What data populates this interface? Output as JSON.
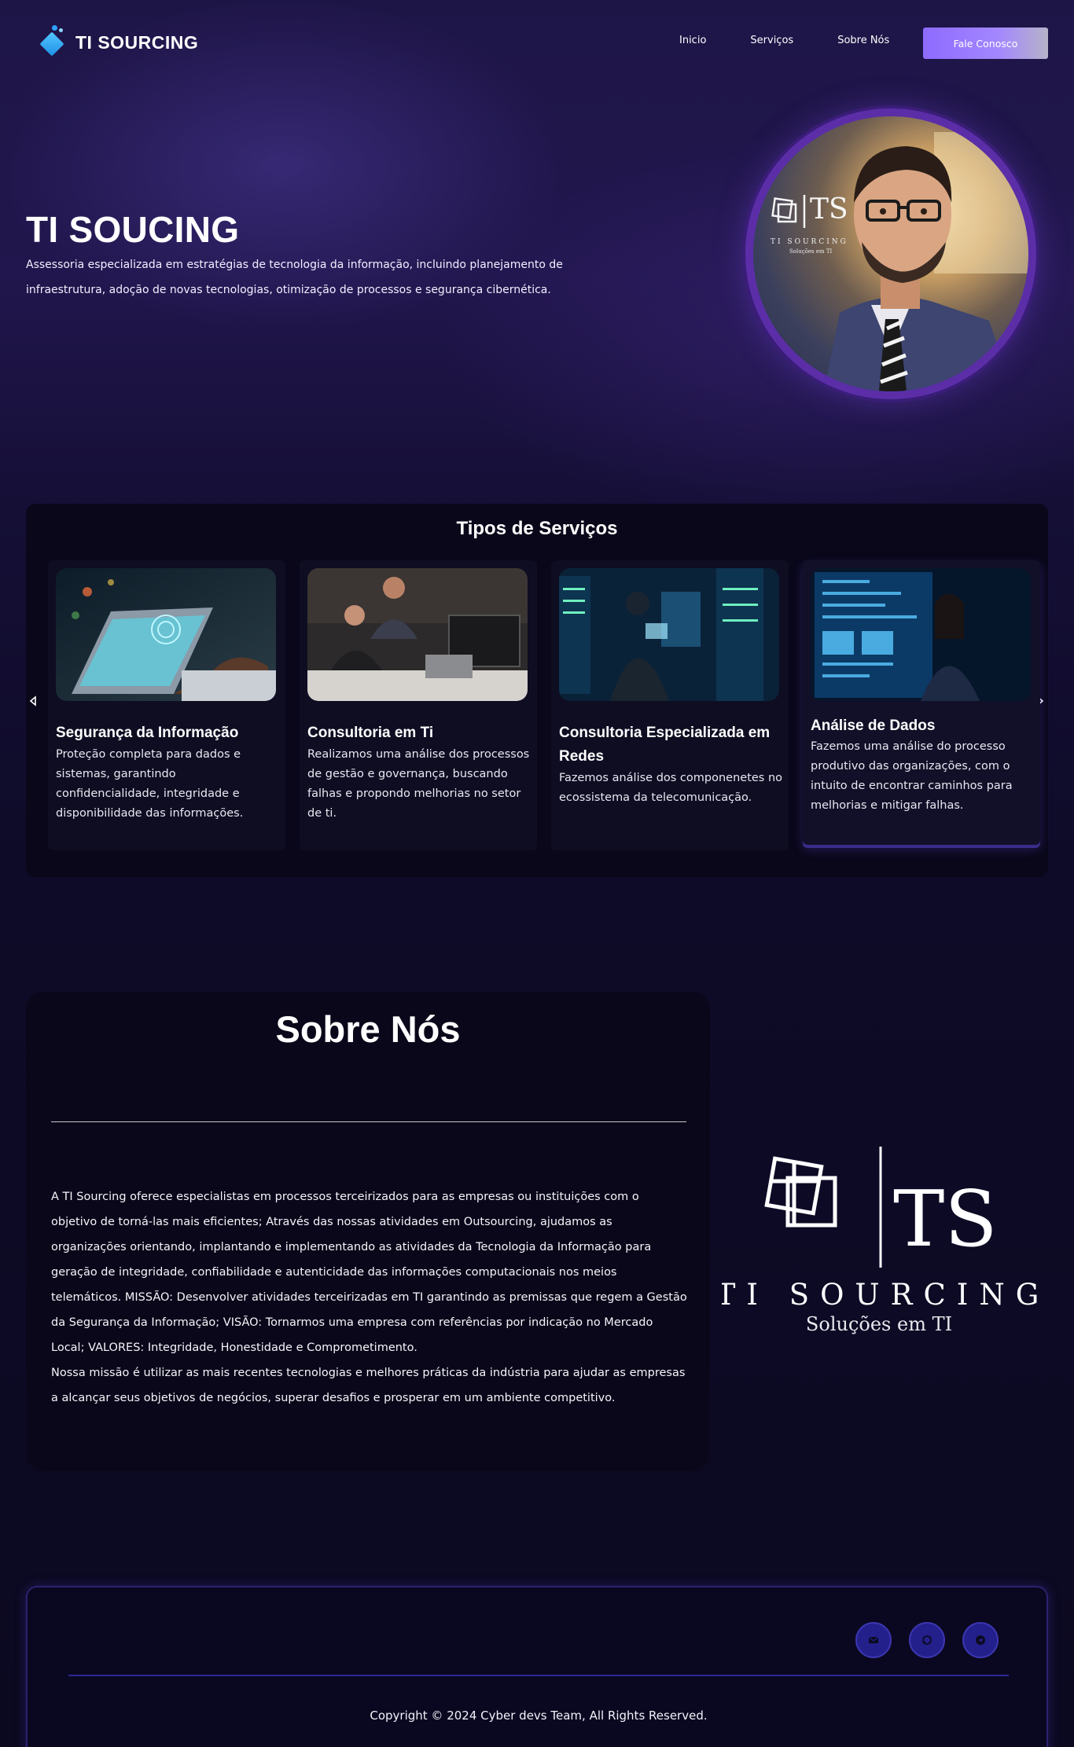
{
  "brand": {
    "name": "TI SOURCING"
  },
  "nav": {
    "links": [
      "Inicio",
      "Serviços",
      "Sobre Nós"
    ],
    "cta": "Fale Conosco"
  },
  "hero": {
    "title": "TI SOUCING",
    "description": "Assessoria especializada em estratégias de tecnologia da informação, incluindo planejamento de infraestrutura, adoção de novas tecnologias, otimização de processos e segurança cibernética.",
    "portrait_logo": {
      "letters": "TS",
      "name": "TI SOURCING",
      "tagline": "Soluções em TI"
    }
  },
  "services": {
    "title": "Tipos de Serviços",
    "cards": [
      {
        "title": "Segurança da Informação",
        "description": "Proteção completa para dados e sistemas, garantindo confidencialidade, integridade e disponibilidade das informações."
      },
      {
        "title": "Consultoria em Ti",
        "description": "Realizamos uma análise dos processos de gestão e governança, buscando falhas e propondo melhorias no setor de ti."
      },
      {
        "title": "Consultoria Especializada em Redes",
        "description": "Fazemos análise dos componenetes no ecossistema da telecomunicação."
      },
      {
        "title": "Análise de Dados",
        "description": "Fazemos uma análise do processo produtivo das organizações, com o intuito de encontrar caminhos para melhorias e mitigar falhas."
      }
    ]
  },
  "about": {
    "title": "Sobre Nós",
    "paragraph1": "A TI Sourcing oferece especialistas em processos terceirizados para as empresas ou instituições com o objetivo de torná-las mais eficientes; Através das nossas atividades em Outsourcing, ajudamos as organizações orientando, implantando e implementando as atividades da Tecnologia da Informação para geração de integridade, confiabilidade e autenticidade das informações computacionais nos meios telemáticos. MISSÃO: Desenvolver atividades terceirizadas em TI garantindo as premissas que regem a Gestão da Segurança da Informação; VISÃO: Tornarmos uma empresa com referências por indicação no Mercado Local; VALORES: Integridade, Honestidade e Comprometimento.",
    "paragraph2": "Nossa missão é utilizar as mais recentes tecnologias e melhores práticas da indústria para ajudar as empresas a alcançar seus objetivos de negócios, superar desafios e prosperar em um ambiente competitivo."
  },
  "brand_logo": {
    "letters": "TS",
    "name": "TI SOURCING",
    "tagline": "Soluções em TI"
  },
  "footer": {
    "social_icons": [
      "email-icon",
      "whatsapp-icon",
      "telegram-icon"
    ],
    "copyright": "Copyright © 2024 Cyber devs Team, All Rights Reserved."
  },
  "colors": {
    "accent": "#8d6bff",
    "background": "#0d0a26",
    "social": "#23208c"
  }
}
